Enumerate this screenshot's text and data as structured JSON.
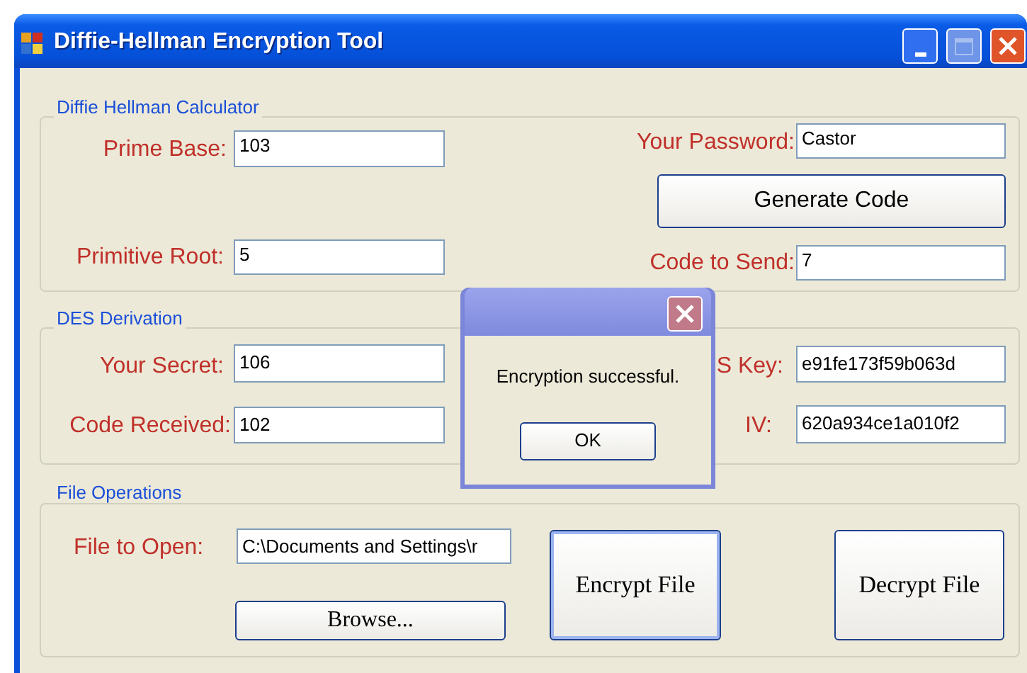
{
  "window": {
    "title": "Diffie-Hellman Encryption Tool"
  },
  "calculator": {
    "title": "Diffie Hellman Calculator",
    "fields": [
      {
        "label": "Prime Base:",
        "value": "103"
      },
      {
        "label": "Your Password:",
        "value": "Castor"
      },
      {
        "label": "Primitive Root:",
        "value": "5"
      },
      {
        "label": "Code to Send:",
        "value": "7"
      }
    ],
    "button": "Generate Code"
  },
  "des": {
    "title": "DES Derivation",
    "fields": [
      {
        "label": "Your Secret:",
        "value": "106"
      },
      {
        "label": "Code Received:",
        "value": "102"
      },
      {
        "label": "S Key:",
        "value": "e91fe173f59b063d"
      },
      {
        "label": "IV:",
        "value": "620a934ce1a010f2"
      }
    ]
  },
  "file_operations": {
    "title": "File Operations",
    "label": "File to Open:",
    "value": "C:\\Documents and Settings\\r",
    "browse_button": "Browse...",
    "encrypt_button": "Encrypt File",
    "decrypt_button": "Decrypt File"
  },
  "message_box": {
    "text": "Encryption successful.",
    "button": "OK"
  }
}
